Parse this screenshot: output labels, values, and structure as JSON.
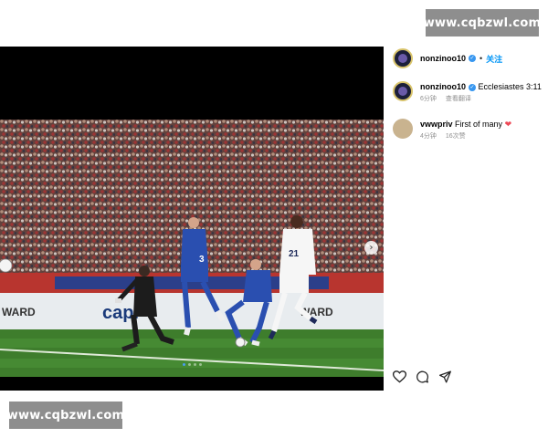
{
  "watermark": {
    "top": "www.cqbzwl.com",
    "bottom": "www.cqbzwl.com"
  },
  "header": {
    "username": "nonzinoo10",
    "separator": "•",
    "follow_label": "关注"
  },
  "comments": [
    {
      "username": "nonzinoo10",
      "text": "Ecclesiastes 3:11",
      "time": "6分钟",
      "action": "查看翻译"
    },
    {
      "username": "vwwpriv",
      "text": "First of many",
      "emoji": "❤",
      "time": "4分钟",
      "likes": "16次赞"
    }
  ],
  "photo": {
    "banner_left": "WARD",
    "banner_center": "capi",
    "banner_right": "WARD",
    "jersey_number_white": "21",
    "jersey_number_blue": "3",
    "next_glyph": "›"
  },
  "carousel": {
    "count": 4,
    "active": 0
  },
  "colors": {
    "accent": "#0095f6",
    "verified": "#3897f0",
    "heart": "#ed4956",
    "watermark_bg": "#8e8e8e",
    "pitch": "#3e7d2c",
    "opponent_kit": "#2a4fb0"
  },
  "icons": {
    "like": "heart-icon",
    "comment": "comment-icon",
    "share": "share-icon"
  }
}
